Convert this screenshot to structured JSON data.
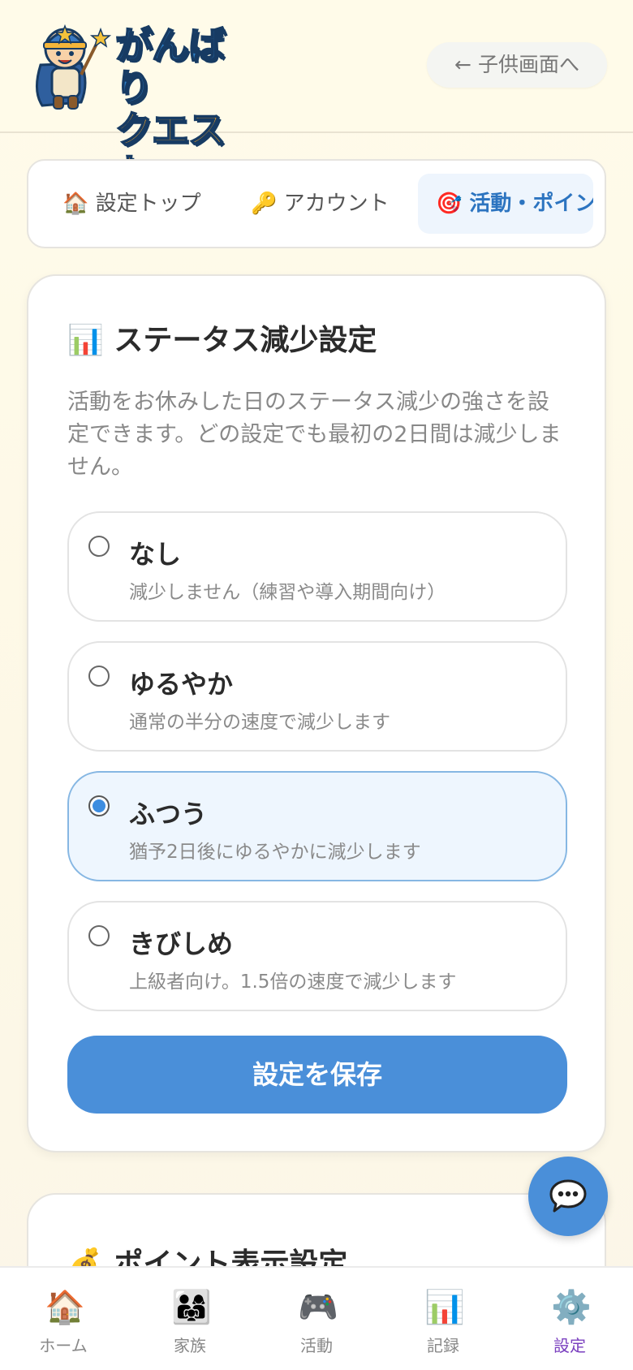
{
  "header": {
    "logo_line1": "がんばり",
    "logo_line2": "クエスト",
    "back_label": "← 子供画面へ"
  },
  "tabs": [
    {
      "icon": "house-icon",
      "label": "🏠 設定トップ"
    },
    {
      "icon": "key-icon",
      "label": "🔑 アカウント"
    },
    {
      "icon": "target-icon",
      "label": "🎯 活動・ポイント",
      "active": true
    }
  ],
  "status_card": {
    "title": "📊 ステータス減少設定",
    "description": "活動をお休みした日のステータス減少の強さを設定できます。どの設定でも最初の2日間は減少しません。",
    "options": [
      {
        "name": "なし",
        "desc": "減少しません（練習や導入期間向け）",
        "selected": false
      },
      {
        "name": "ゆるやか",
        "desc": "通常の半分の速度で減少します",
        "selected": false
      },
      {
        "name": "ふつう",
        "desc": "猶予2日後にゆるやかに減少します",
        "selected": true
      },
      {
        "name": "きびしめ",
        "desc": "上級者向け。1.5倍の速度で減少します",
        "selected": false
      }
    ],
    "save_label": "設定を保存"
  },
  "points_card": {
    "title": "💰 ポイント表示設定"
  },
  "bottom_nav": [
    {
      "icon": "🏠",
      "label": "ホーム",
      "active": false
    },
    {
      "icon": "👨‍👩‍👧",
      "label": "家族",
      "active": false
    },
    {
      "icon": "🎮",
      "label": "活動",
      "active": false
    },
    {
      "icon": "📊",
      "label": "記録",
      "active": false
    },
    {
      "icon": "⚙️",
      "label": "設定",
      "active": true
    }
  ],
  "colors": {
    "accent": "#4a8fd9",
    "active_nav": "#7a3fbf",
    "active_tab_text": "#2c74c0"
  }
}
